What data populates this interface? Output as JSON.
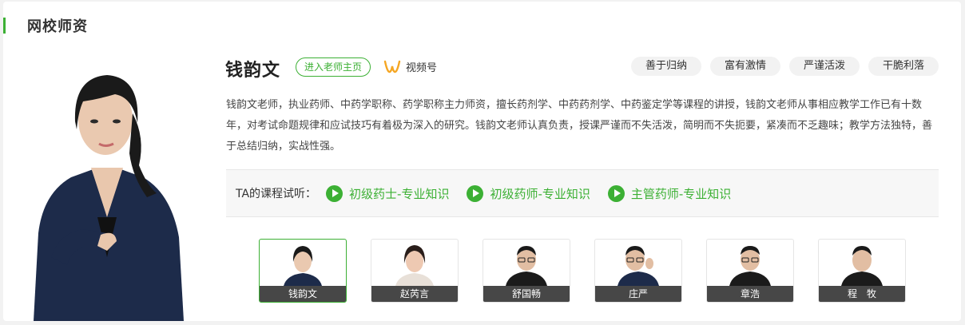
{
  "section": {
    "title": "网校师资"
  },
  "teacher": {
    "name": "钱韵文",
    "home_button": "进入老师主页",
    "video_label": "视频号",
    "tags": [
      "善于归纳",
      "富有激情",
      "严谨活泼",
      "干脆利落"
    ],
    "intro": "钱韵文老师，执业药师、中药学职称、药学职称主力师资，擅长药剂学、中药药剂学、中药鉴定学等课程的讲授，钱韵文老师从事相应教学工作已有十数年，对考试命题规律和应试技巧有着极为深入的研究。钱韵文老师认真负责，授课严谨而不失活泼，简明而不失扼要，紧凑而不乏趣味；教学方法独特，善于总结归纳，实战性强。"
  },
  "courses": {
    "label": "TA的课程试听：",
    "items": [
      "初级药士-专业知识",
      "初级药师-专业知识",
      "主管药师-专业知识"
    ]
  },
  "teachers": [
    {
      "name": "钱韵文",
      "active": true
    },
    {
      "name": "赵芮言",
      "active": false
    },
    {
      "name": "舒国畅",
      "active": false
    },
    {
      "name": "庄严",
      "active": false
    },
    {
      "name": "章浩",
      "active": false
    },
    {
      "name": "程　牧",
      "active": false
    }
  ],
  "colors": {
    "accent": "#3cb034",
    "video_icon": "#f5a623"
  },
  "icons": {
    "video": "video-channel-icon",
    "play": "play-icon"
  }
}
